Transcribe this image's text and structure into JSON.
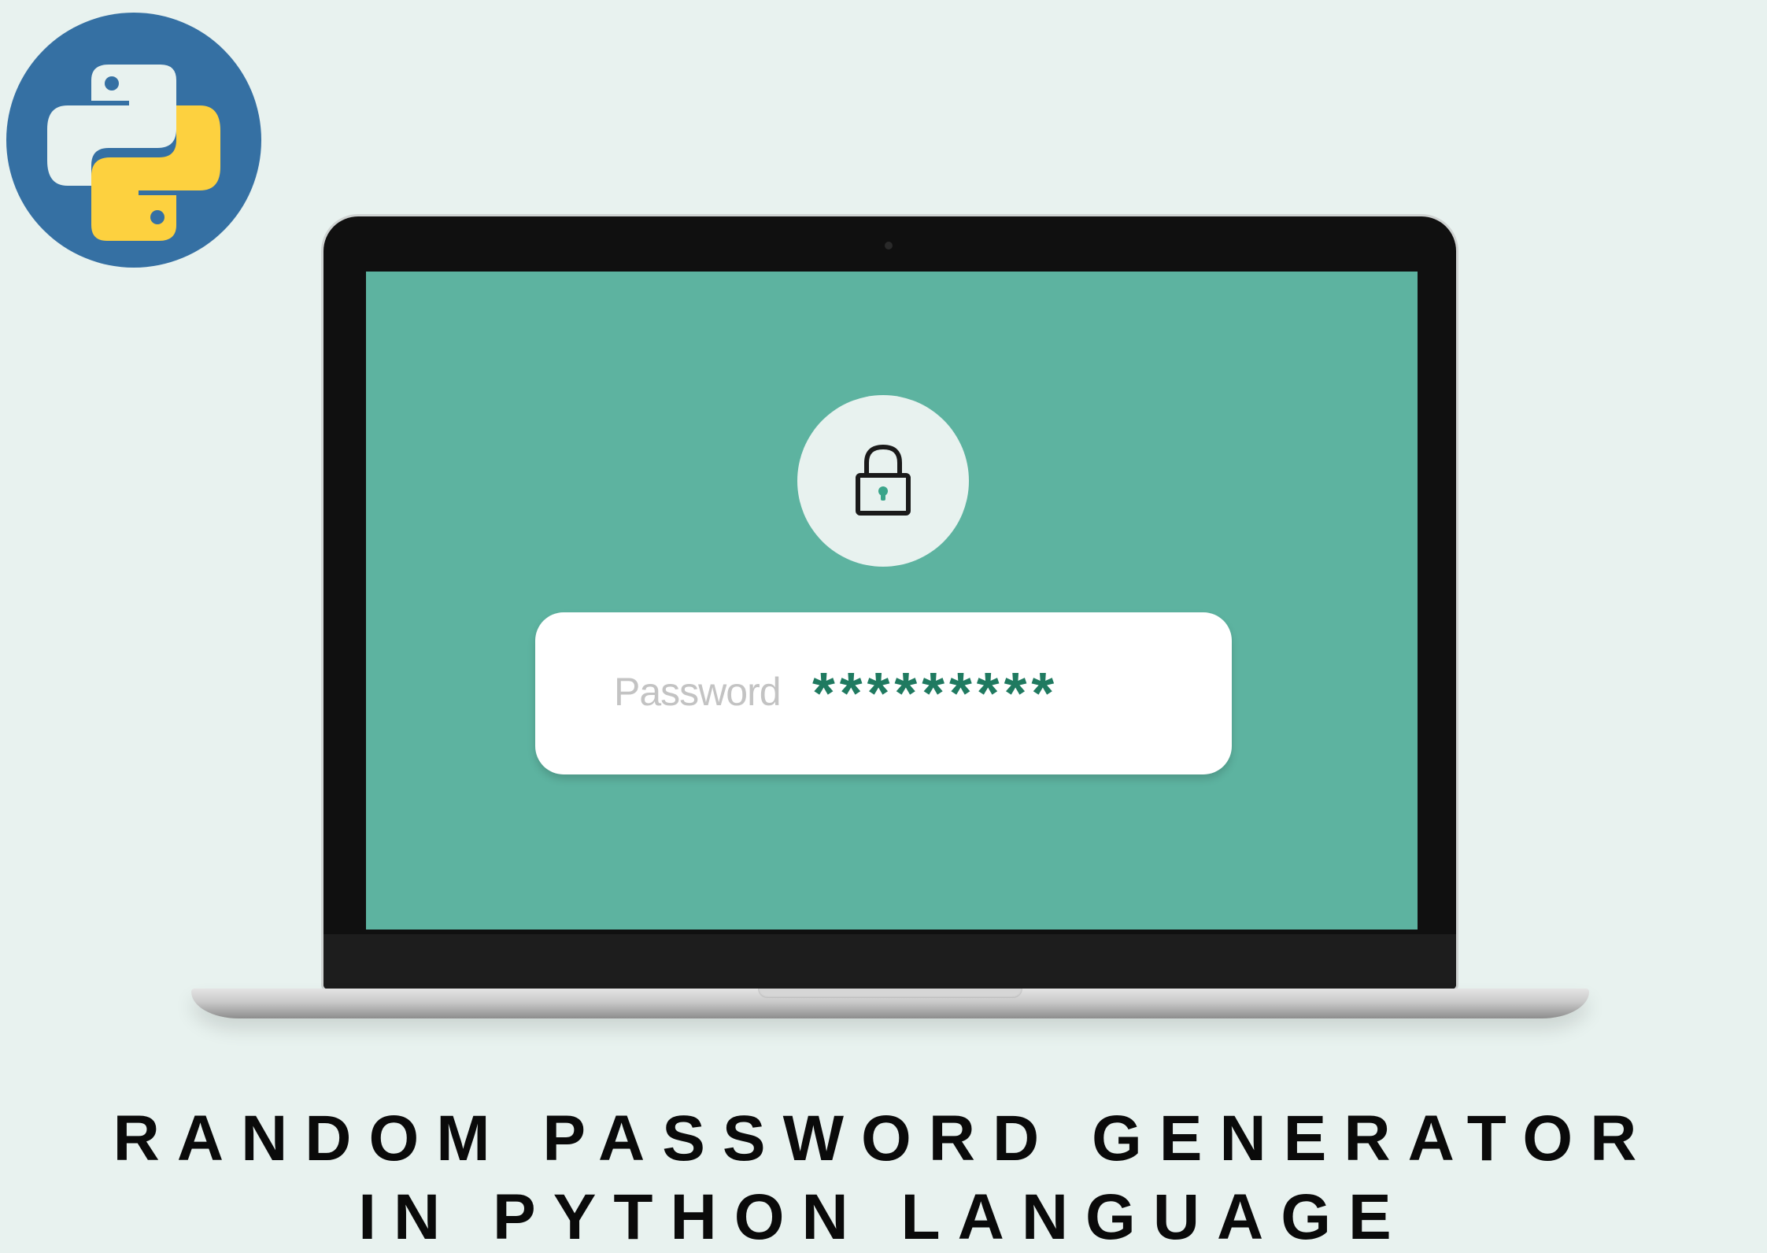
{
  "logo": {
    "icon": "python-logo-icon",
    "colors": {
      "blue": "#3570a3",
      "yellow": "#fdd13f",
      "light": "#e8f2ef"
    }
  },
  "screen": {
    "icon": "lock-icon",
    "password_field": {
      "label": "Password",
      "value": "*********"
    },
    "colors": {
      "screen": "#5db3a0",
      "value": "#1f7a60"
    }
  },
  "title": {
    "line1": "RANDOM PASSWORD GENERATOR",
    "line2": "IN PYTHON LANGUAGE"
  }
}
